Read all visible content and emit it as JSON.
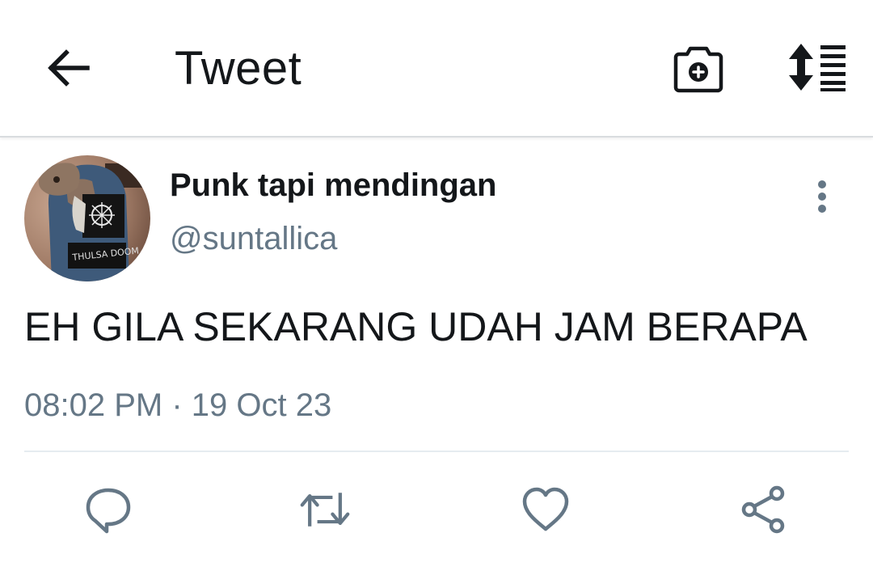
{
  "header": {
    "title": "Tweet",
    "icons": {
      "back": "arrow-left-icon",
      "camera": "camera-add-icon",
      "sort": "sort-list-icon"
    }
  },
  "tweet": {
    "display_name": "Punk tapi mendingan",
    "handle": "@suntallica",
    "text": "EH GILA SEKARANG UDAH JAM BERAPA",
    "timestamp": "08:02 PM · 19 Oct 23",
    "avatar_text": "THULSA DOOM"
  },
  "actions": {
    "icons": [
      "reply-icon",
      "retweet-icon",
      "like-icon",
      "share-icon"
    ]
  },
  "colors": {
    "text_primary": "#14171a",
    "text_secondary": "#657786",
    "icon_gray": "#657786",
    "divider": "#e6ecf0"
  }
}
